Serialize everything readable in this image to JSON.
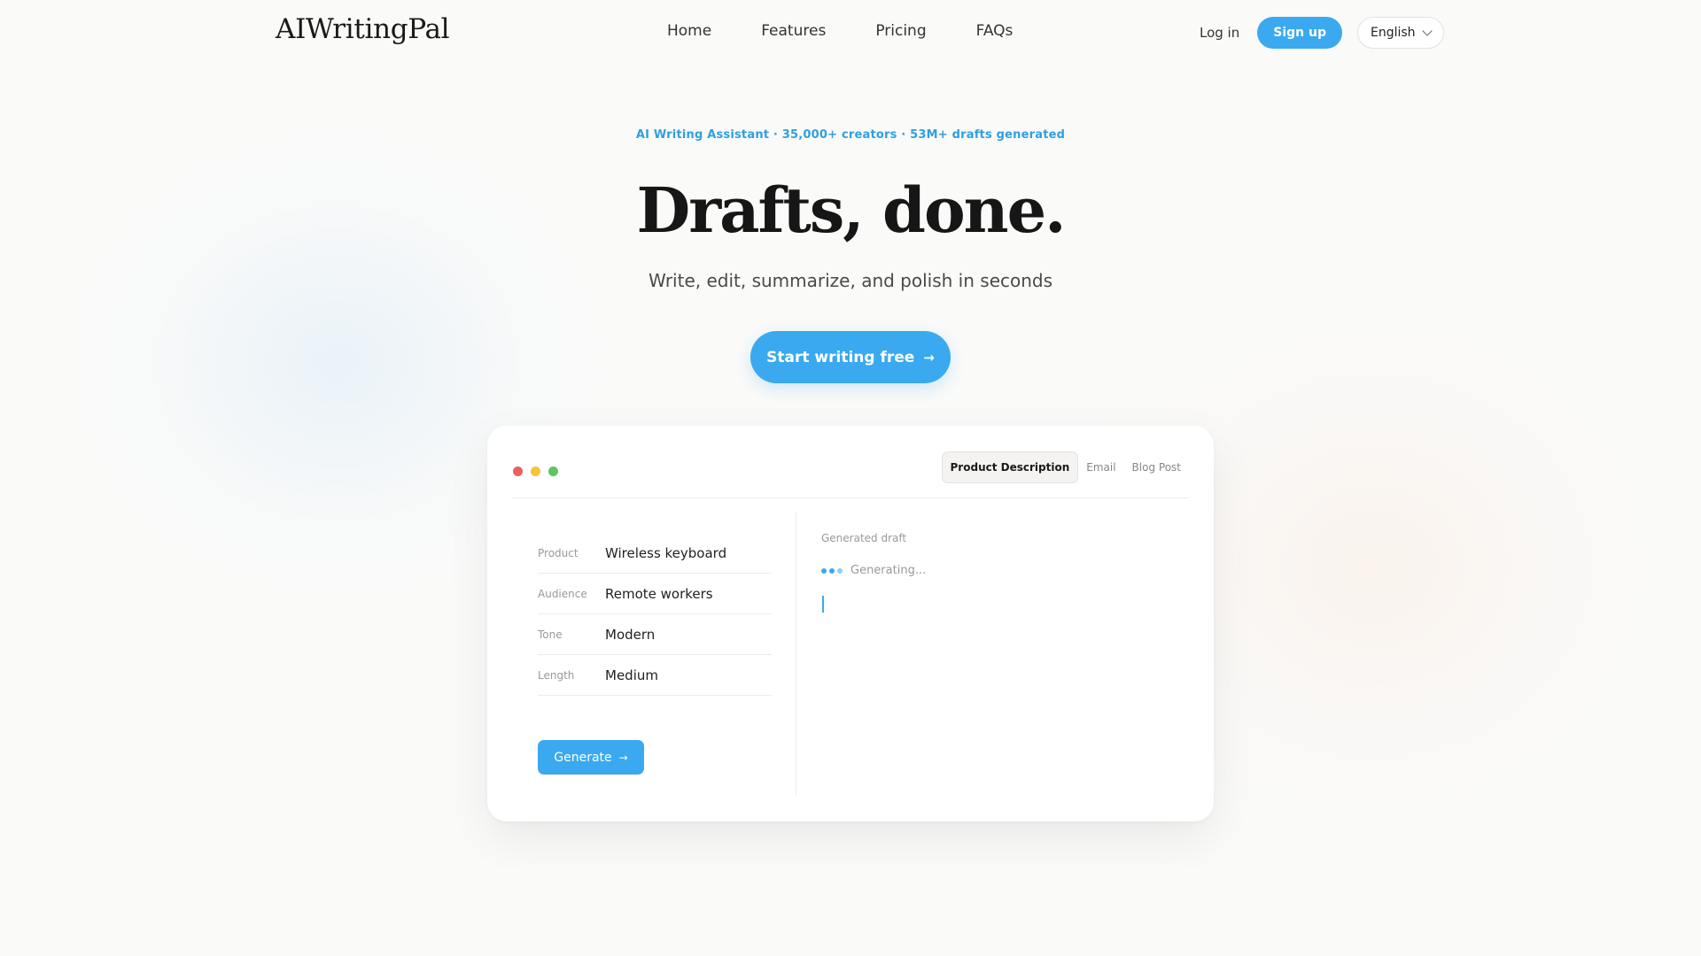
{
  "nav": {
    "logo": "AIWritingPal",
    "links": [
      "Home",
      "Features",
      "Pricing",
      "FAQs"
    ],
    "login_label": "Log in",
    "signup_label": "Sign up",
    "language": "English"
  },
  "hero": {
    "eyebrow": "AI Writing Assistant · 35,000+ creators · 53M+ drafts generated",
    "headline": "Drafts, done.",
    "subhead": "Write, edit, summarize, and polish in seconds",
    "cta_label": "Start writing free",
    "cta_icon": "arrow-right-icon"
  },
  "demo": {
    "window_dots": [
      "#ec5f5f",
      "#f3c53b",
      "#5fc462"
    ],
    "tabs": [
      {
        "label": "Product Description",
        "active": true
      },
      {
        "label": "Email",
        "active": false
      },
      {
        "label": "Blog Post",
        "active": false
      }
    ],
    "fields": [
      {
        "label": "Product",
        "value": "Wireless keyboard"
      },
      {
        "label": "Audience",
        "value": "Remote workers"
      },
      {
        "label": "Tone",
        "value": "Modern"
      },
      {
        "label": "Length",
        "value": "Medium"
      }
    ],
    "generate_label": "Generate",
    "output_label": "Generated draft",
    "status_text": "Generating..."
  },
  "colors": {
    "accent": "#3aa9ef",
    "eyebrow": "#2f9fe0",
    "background": "#fafaf9"
  }
}
